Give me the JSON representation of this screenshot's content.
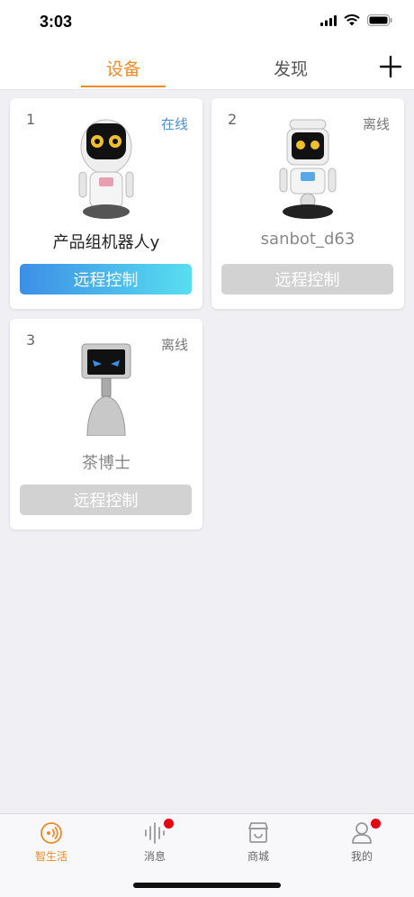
{
  "status_bar": {
    "time": "3:03"
  },
  "header": {
    "tabs": [
      {
        "label": "设备",
        "active": true
      },
      {
        "label": "发现",
        "active": false
      }
    ],
    "add_icon": "plus-icon"
  },
  "colors": {
    "accent": "#f08a24",
    "online": "#4a90d9",
    "offline_btn": "#d2d2d2",
    "badge": "#e60012"
  },
  "devices": [
    {
      "index": "1",
      "status": "在线",
      "name": "产品组机器人y",
      "button": "远程控制",
      "online": true
    },
    {
      "index": "2",
      "status": "离线",
      "name": "sanbot_d63",
      "button": "远程控制",
      "online": false
    },
    {
      "index": "3",
      "status": "离线",
      "name": "茶博士",
      "button": "远程控制",
      "online": false
    }
  ],
  "bottom_nav": [
    {
      "label": "智生活",
      "icon": "smart-life-icon",
      "active": true,
      "badge": false
    },
    {
      "label": "消息",
      "icon": "message-waveform-icon",
      "active": false,
      "badge": true
    },
    {
      "label": "商城",
      "icon": "store-icon",
      "active": false,
      "badge": false
    },
    {
      "label": "我的",
      "icon": "profile-icon",
      "active": false,
      "badge": true
    }
  ]
}
